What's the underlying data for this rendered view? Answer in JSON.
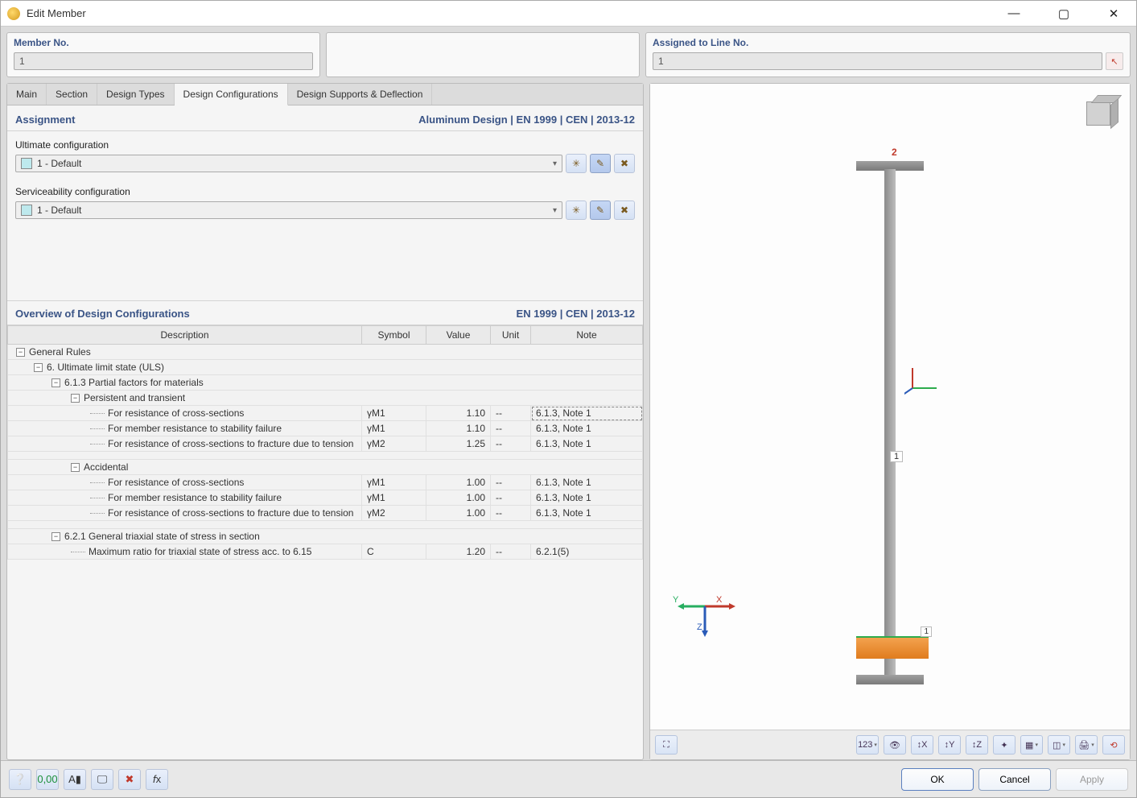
{
  "window": {
    "title": "Edit Member",
    "min": "—",
    "max": "▢",
    "close": "✕"
  },
  "header": {
    "member_no_label": "Member No.",
    "member_no_value": "1",
    "assigned_label": "Assigned to Line No.",
    "assigned_value": "1"
  },
  "tabs": {
    "main": "Main",
    "section": "Section",
    "design_types": "Design Types",
    "design_configs": "Design Configurations",
    "supports": "Design Supports & Deflection"
  },
  "assignment": {
    "heading": "Assignment",
    "code": "Aluminum Design | EN 1999 | CEN | 2013-12",
    "ultimate_label": "Ultimate configuration",
    "ultimate_value": "1 - Default",
    "service_label": "Serviceability configuration",
    "service_value": "1 - Default"
  },
  "overview": {
    "heading": "Overview of Design Configurations",
    "code": "EN 1999 | CEN | 2013-12",
    "columns": {
      "description": "Description",
      "symbol": "Symbol",
      "value": "Value",
      "unit": "Unit",
      "note": "Note"
    },
    "general_rules": "General Rules",
    "uls": "6. Ultimate limit state (ULS)",
    "partial_factors": "6.1.3 Partial factors for materials",
    "persistent": "Persistent and transient",
    "accidental": "Accidental",
    "triaxial_section": "6.2.1 General triaxial state of stress in section",
    "rows_persistent": [
      {
        "desc": "For resistance of cross-sections",
        "sym": "γM1",
        "val": "1.10",
        "unit": "--",
        "note": "6.1.3, Note 1"
      },
      {
        "desc": "For member resistance to stability failure",
        "sym": "γM1",
        "val": "1.10",
        "unit": "--",
        "note": "6.1.3, Note 1"
      },
      {
        "desc": "For resistance of cross-sections to fracture due to tension",
        "sym": "γM2",
        "val": "1.25",
        "unit": "--",
        "note": "6.1.3, Note 1"
      }
    ],
    "rows_accidental": [
      {
        "desc": "For resistance of cross-sections",
        "sym": "γM1",
        "val": "1.00",
        "unit": "--",
        "note": "6.1.3, Note 1"
      },
      {
        "desc": "For member resistance to stability failure",
        "sym": "γM1",
        "val": "1.00",
        "unit": "--",
        "note": "6.1.3, Note 1"
      },
      {
        "desc": "For resistance of cross-sections to fracture due to tension",
        "sym": "γM2",
        "val": "1.00",
        "unit": "--",
        "note": "6.1.3, Note 1"
      }
    ],
    "rows_triaxial": [
      {
        "desc": "Maximum ratio for triaxial state of stress acc. to 6.15",
        "sym": "C",
        "val": "1.20",
        "unit": "--",
        "note": "6.2.1(5)"
      }
    ]
  },
  "viewport": {
    "member_label": "1",
    "node_top": "2",
    "support_label": "1",
    "axes": {
      "x": "X",
      "y": "Y",
      "z": "Z"
    }
  },
  "buttons": {
    "ok": "OK",
    "cancel": "Cancel",
    "apply": "Apply"
  }
}
